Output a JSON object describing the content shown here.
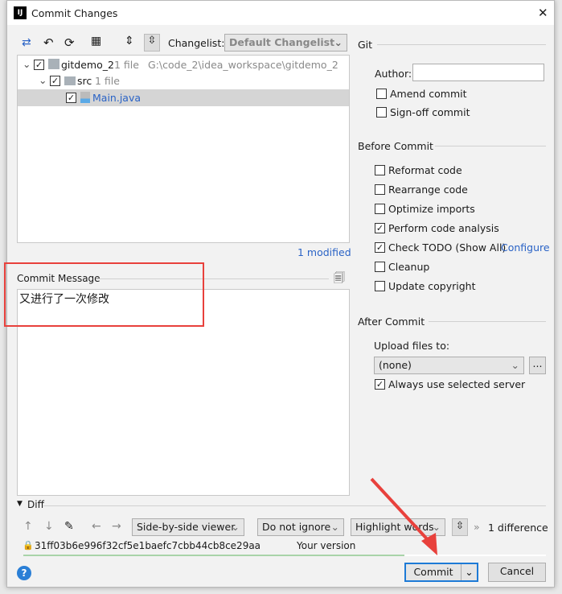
{
  "window": {
    "title": "Commit Changes",
    "close": "✕"
  },
  "toolbar": {
    "changelist_label": "Changelist:",
    "changelist_value": "Default Changelist"
  },
  "tree": [
    {
      "name": "gitdemo_2",
      "count": "1 file",
      "path": "G:\\code_2\\idea_workspace\\gitdemo_2",
      "checked": true
    },
    {
      "name": "src",
      "count": "1 file",
      "checked": true
    },
    {
      "name": "Main.java",
      "checked": true,
      "selected": true
    }
  ],
  "modified": "1 modified",
  "commit_message": {
    "label": "Commit Message",
    "value": "又进行了一次修改"
  },
  "git": {
    "title": "Git",
    "author_label": "Author:",
    "author_value": "",
    "amend": "Amend commit",
    "signoff": "Sign-off commit"
  },
  "before_commit": {
    "title": "Before Commit",
    "options": [
      {
        "label": "Reformat code",
        "checked": false
      },
      {
        "label": "Rearrange code",
        "checked": false
      },
      {
        "label": "Optimize imports",
        "checked": false
      },
      {
        "label": "Perform code analysis",
        "checked": true
      },
      {
        "label": "Check TODO (Show All)",
        "checked": true,
        "link": "Configure"
      },
      {
        "label": "Cleanup",
        "checked": false
      },
      {
        "label": "Update copyright",
        "checked": false
      }
    ]
  },
  "after_commit": {
    "title": "After Commit",
    "upload_label": "Upload files to:",
    "upload_value": "(none)",
    "more": "...",
    "always_label": "Always use selected server",
    "always_checked": true
  },
  "diff": {
    "title": "Diff",
    "viewer": "Side-by-side viewer",
    "ignore": "Do not ignore",
    "highlight": "Highlight words",
    "differences": "1 difference",
    "revision": "31ff03b6e996f32cf5e1baefc7cbb44cb8ce29aa",
    "your_version": "Your version"
  },
  "buttons": {
    "help": "?",
    "commit": "Commit",
    "cancel": "Cancel"
  },
  "colors": {
    "accent": "#2a63c6",
    "annotation": "#e8413c"
  }
}
